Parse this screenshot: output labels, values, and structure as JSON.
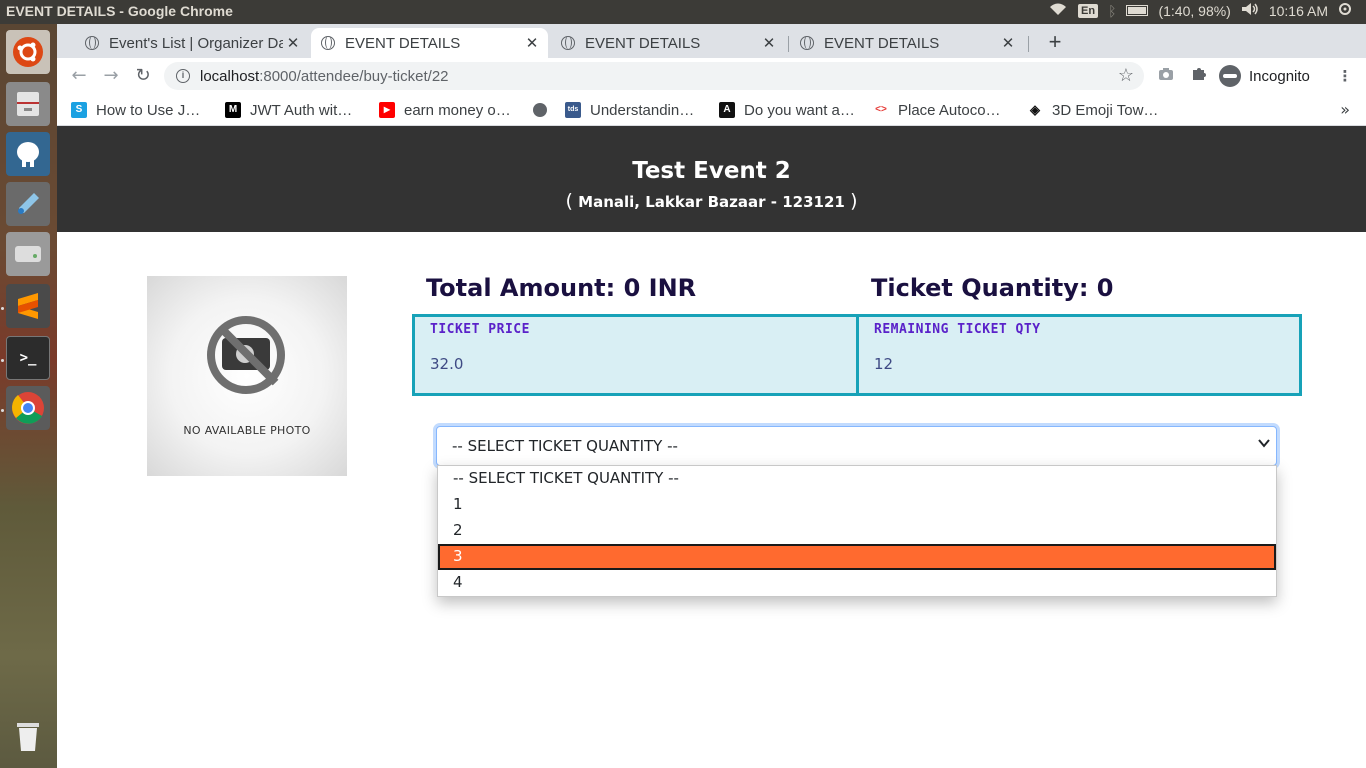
{
  "os": {
    "window_title": "EVENT DETAILS - Google Chrome",
    "keyboard_layout": "En",
    "battery": "(1:40, 98%)",
    "clock": "10:16 AM"
  },
  "browser": {
    "tabs": [
      {
        "label": "Event's List | Organizer Da",
        "active": false
      },
      {
        "label": "EVENT DETAILS",
        "active": true
      },
      {
        "label": "EVENT DETAILS",
        "active": false
      },
      {
        "label": "EVENT DETAILS",
        "active": false
      }
    ],
    "new_tab": "+",
    "url_host": "localhost",
    "url_path": ":8000/attendee/buy-ticket/22",
    "profile_label": "Incognito",
    "bookmarks": [
      {
        "label": "How to Use J…",
        "icon": "s-icon",
        "color": "#1ba1e2",
        "glyph": "S"
      },
      {
        "label": "JWT Auth wit…",
        "icon": "medium-icon",
        "color": "#000000",
        "glyph": "M"
      },
      {
        "label": "earn money o…",
        "icon": "youtube-icon",
        "color": "#ff0000",
        "glyph": "▶"
      },
      {
        "label": "",
        "icon": "globe-icon",
        "color": "#5f6368",
        "glyph": ""
      },
      {
        "label": "Understandin…",
        "icon": "tds-icon",
        "color": "#3a5a8c",
        "glyph": "tds"
      },
      {
        "label": "Do you want a…",
        "icon": "angular-icon",
        "color": "#111111",
        "glyph": "A"
      },
      {
        "label": "Place Autoco…",
        "icon": "chevrons-icon",
        "color": "#ffffff",
        "glyph": "<>"
      },
      {
        "label": "3D Emoji Tow…",
        "icon": "codepen-icon",
        "color": "#ffffff",
        "glyph": "◈"
      }
    ]
  },
  "event": {
    "title": "Test Event 2",
    "location_open": "(",
    "location": "Manali, Lakkar Bazaar - 123121",
    "location_close": ")",
    "photo_caption": "NO AVAILABLE PHOTO"
  },
  "summary": {
    "total_amount": "Total Amount: 0 INR",
    "ticket_quantity": "Ticket Quantity: 0"
  },
  "info": {
    "price_label": "TICKET PRICE",
    "price_value": "32.0",
    "remaining_label": "REMAINING TICKET QTY",
    "remaining_value": "12"
  },
  "quantity_select": {
    "selected": "-- SELECT TICKET QUANTITY --",
    "options": [
      "-- SELECT TICKET QUANTITY --",
      "1",
      "2",
      "3",
      "4"
    ],
    "highlighted_index": 3
  },
  "colors": {
    "hero_bg": "#333333",
    "info_border": "#17a2b8",
    "info_bg": "#d9eff4",
    "highlight": "#ff6a2f"
  }
}
